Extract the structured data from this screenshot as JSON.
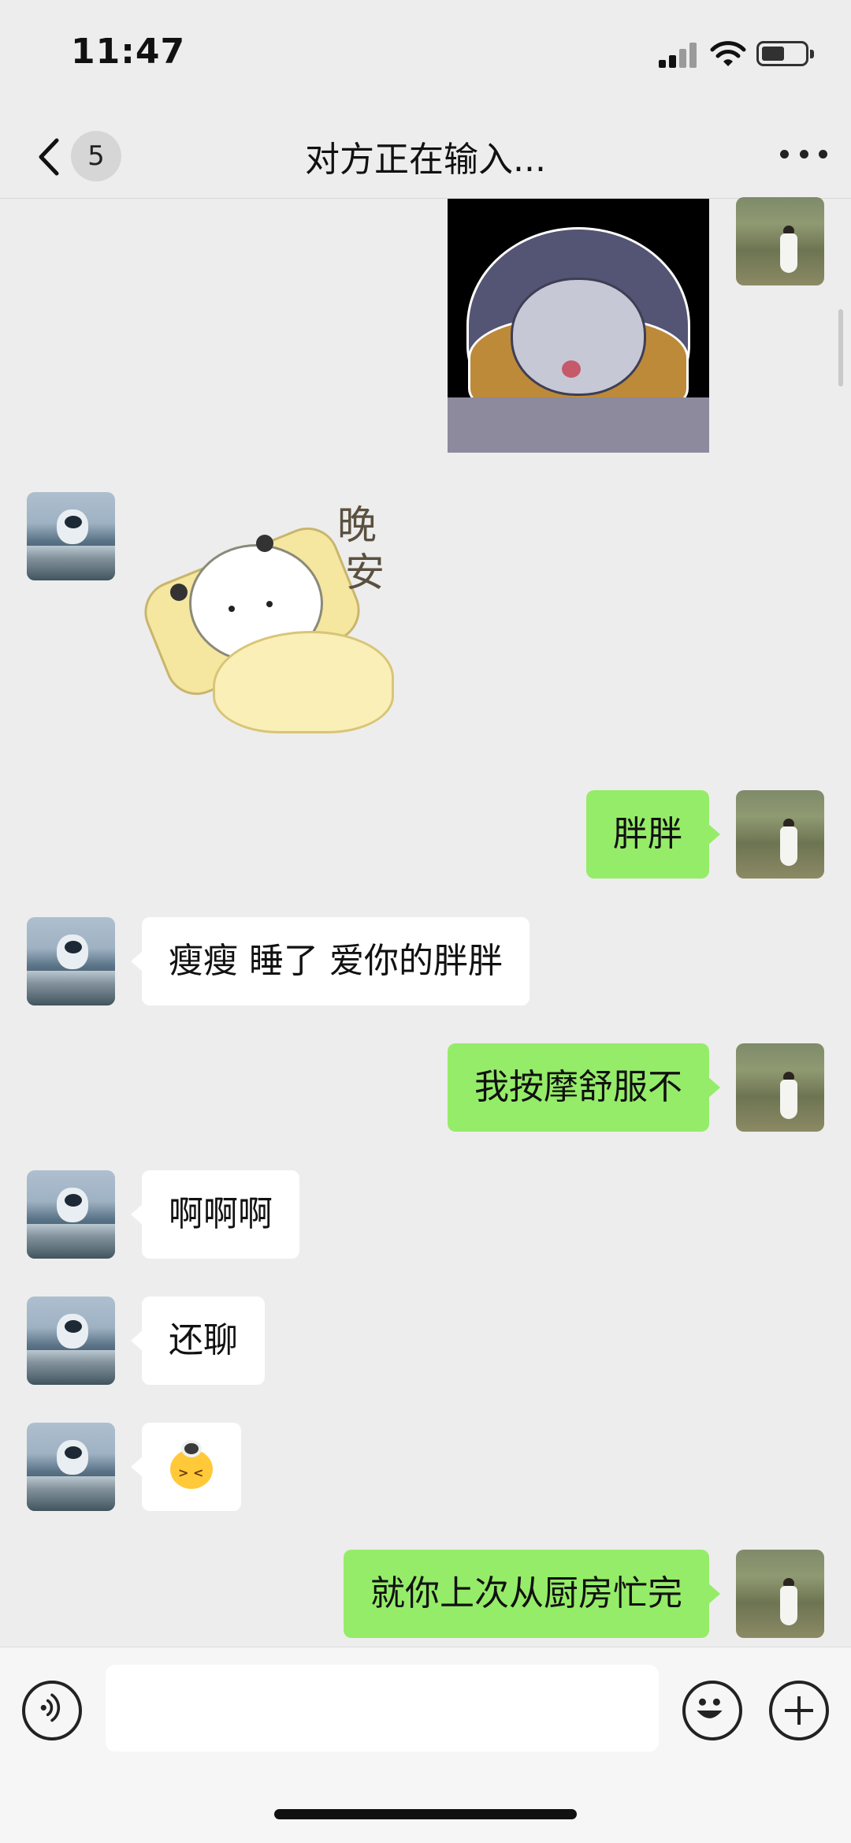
{
  "status_bar": {
    "time": "11:47"
  },
  "header": {
    "unread_count": "5",
    "title": "对方正在输入..."
  },
  "stickers": {
    "goodnight_text_1": "晚",
    "goodnight_text_2": "安"
  },
  "messages": [
    {
      "side": "out",
      "type": "sticker",
      "name": "sleeping-bun-sticker"
    },
    {
      "side": "in",
      "type": "sticker",
      "name": "goodnight-sticker"
    },
    {
      "side": "out",
      "type": "text",
      "text": "胖胖"
    },
    {
      "side": "in",
      "type": "text",
      "text": "瘦瘦 睡了 爱你的胖胖"
    },
    {
      "side": "out",
      "type": "text",
      "text": "我按摩舒服不"
    },
    {
      "side": "in",
      "type": "text",
      "text": "啊啊啊"
    },
    {
      "side": "in",
      "type": "text",
      "text": "还聊"
    },
    {
      "side": "in",
      "type": "emoji",
      "name": "frustrated-emoji"
    },
    {
      "side": "out",
      "type": "text",
      "text": "就你上次从厨房忙完"
    }
  ],
  "input": {
    "value": ""
  },
  "colors": {
    "outgoing_bubble": "#95ec69",
    "incoming_bubble": "#ffffff",
    "background": "#ededed"
  }
}
